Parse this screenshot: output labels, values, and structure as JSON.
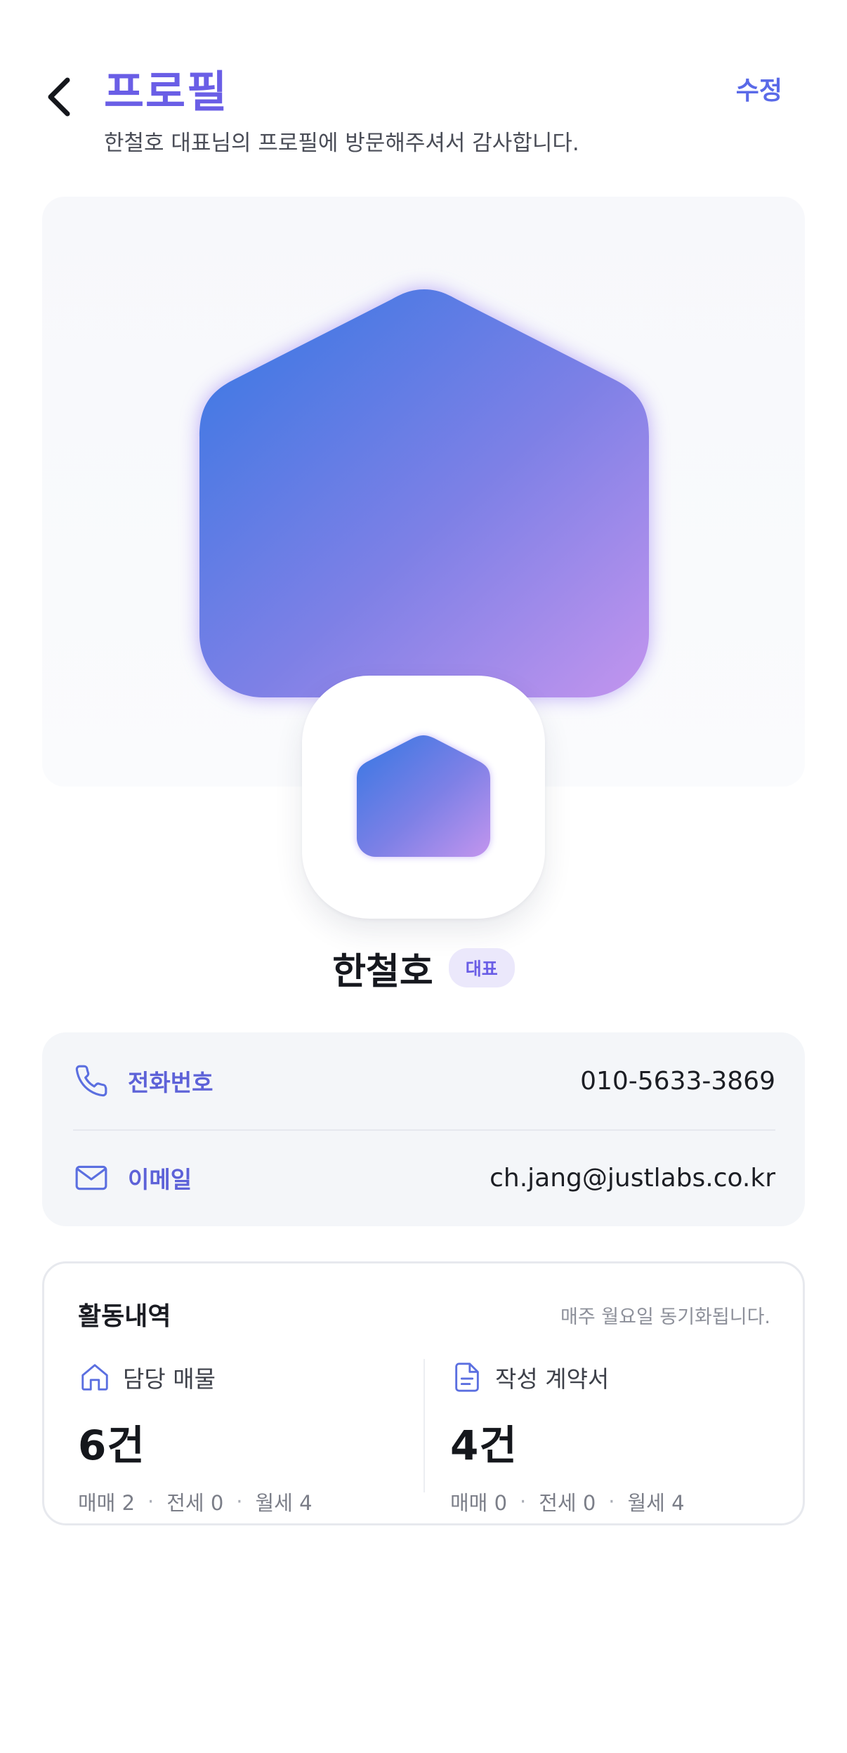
{
  "header": {
    "title": "프로필",
    "edit_label": "수정",
    "subtitle": "한철호 대표님의 프로필에 방문해주셔서 감사합니다."
  },
  "icons": {
    "back": "chevron-left-icon",
    "phone": "phone-icon",
    "email": "mail-icon",
    "property": "home-icon",
    "contract": "document-icon"
  },
  "colors": {
    "accent": "#6a5ee6",
    "gradient_start": "#3b7de2",
    "gradient_end": "#c093ee",
    "label_blue": "#5d62d8"
  },
  "profile": {
    "name": "한철호",
    "role": "대표"
  },
  "contact": {
    "phone_label": "전화번호",
    "phone_value": "010-5633-3869",
    "email_label": "이메일",
    "email_value": "ch.jang@justlabs.co.kr"
  },
  "activity": {
    "title": "활동내역",
    "sync_note": "매주 월요일 동기화됩니다.",
    "listings": {
      "label": "담당 매물",
      "total": "6건",
      "breakdown": [
        "매매 2",
        "전세 0",
        "월세 4"
      ]
    },
    "contracts": {
      "label": "작성 계약서",
      "total": "4건",
      "breakdown": [
        "매매 0",
        "전세 0",
        "월세 4"
      ]
    }
  }
}
